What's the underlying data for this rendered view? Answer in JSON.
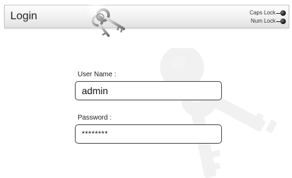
{
  "header": {
    "title": "Login",
    "indicators": [
      {
        "label": "Caps Lock",
        "icon": "indicator-led-icon"
      },
      {
        "label": "Num Lock",
        "icon": "indicator-led-icon"
      }
    ]
  },
  "form": {
    "username": {
      "label": "User Name :",
      "value": "admin"
    },
    "password": {
      "label": "Password :",
      "value": "********"
    }
  },
  "decor": {
    "header_icon": "keys-icon",
    "background_icon": "keys-watermark-icon"
  }
}
